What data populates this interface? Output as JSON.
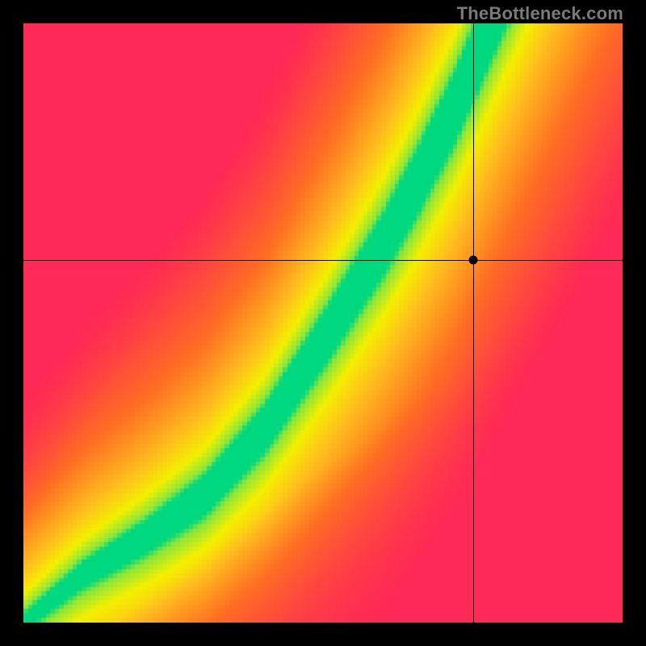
{
  "watermark": "TheBottleneck.com",
  "chart_data": {
    "type": "heatmap",
    "title": "",
    "xlabel": "",
    "ylabel": "",
    "xlim": [
      0,
      1
    ],
    "ylim": [
      0,
      1
    ],
    "crosshair": {
      "x": 0.75,
      "y": 0.605
    },
    "marker": {
      "x": 0.75,
      "y": 0.605
    },
    "optimal_curve_points": [
      [
        0.0,
        0.0
      ],
      [
        0.1,
        0.08
      ],
      [
        0.2,
        0.14
      ],
      [
        0.3,
        0.21
      ],
      [
        0.4,
        0.32
      ],
      [
        0.5,
        0.47
      ],
      [
        0.6,
        0.63
      ],
      [
        0.66,
        0.74
      ],
      [
        0.72,
        0.86
      ],
      [
        0.78,
        1.0
      ]
    ],
    "palette": {
      "optimal": "#00d880",
      "transition": "#f4f000",
      "cpu_limited": "#ff2a55",
      "gpu_limited": "#ff2a55",
      "mid_warm": "#ff9a1a"
    }
  }
}
